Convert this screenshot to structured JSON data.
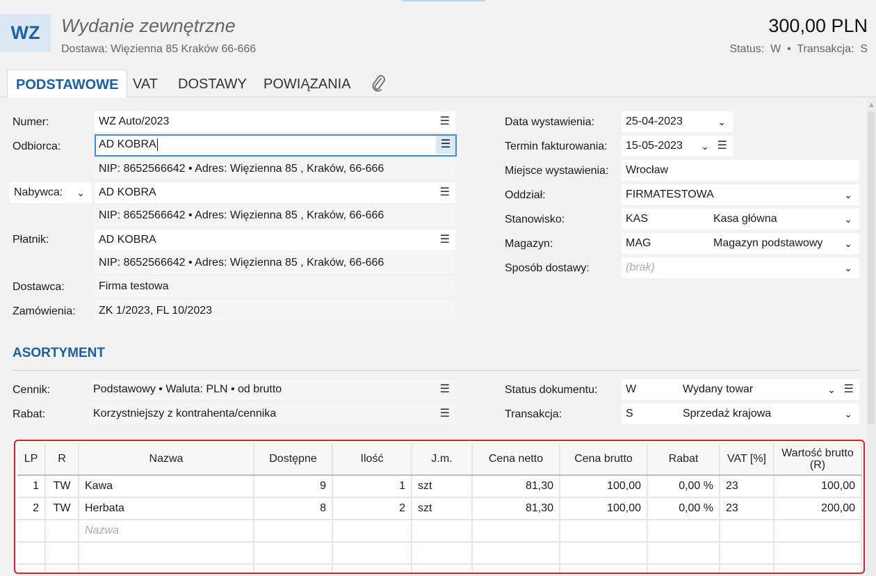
{
  "header": {
    "doc_code": "WZ",
    "title": "Wydanie zewnętrzne",
    "subtitle": "Dostawa: Więzienna  85  Kraków 66-666",
    "amount": "300,00 PLN",
    "status_line": "Status:  W  •  Transakcja:  S"
  },
  "tabs": [
    {
      "label": "PODSTAWOWE",
      "active": true
    },
    {
      "label": "VAT"
    },
    {
      "label": "DOSTAWY"
    },
    {
      "label": "POWIĄZANIA"
    }
  ],
  "left": {
    "numer_label": "Numer:",
    "numer_value": "WZ Auto/2023",
    "odbiorca_label": "Odbiorca:",
    "odbiorca_value": "AD KOBRA",
    "odbiorca_info": "NIP:  8652566642  •  Adres:  Więzienna  85 , Kraków, 66-666",
    "nabywca_label": "Nabywca:",
    "nabywca_value": "AD KOBRA",
    "nabywca_info": "NIP:  8652566642  •  Adres:  Więzienna  85 , Kraków, 66-666",
    "platnik_label": "Płatnik:",
    "platnik_value": "AD KOBRA",
    "platnik_info": "NIP:  8652566642  •  Adres:  Więzienna  85 , Kraków, 66-666",
    "dostawca_label": "Dostawca:",
    "dostawca_value": "Firma testowa",
    "zamowienia_label": "Zamówienia:",
    "zamowienia_value": "ZK 1/2023, FL 10/2023"
  },
  "right": {
    "data_wyst_label": "Data wystawienia:",
    "data_wyst_value": "25-04-2023",
    "termin_label": "Termin fakturowania:",
    "termin_value": "15-05-2023",
    "miejsce_label": "Miejsce wystawienia:",
    "miejsce_value": "Wrocław",
    "oddzial_label": "Oddział:",
    "oddzial_value": "FIRMATESTOWA",
    "stanowisko_label": "Stanowisko:",
    "stanowisko_code": "KAS",
    "stanowisko_name": "Kasa główna",
    "magazyn_label": "Magazyn:",
    "magazyn_code": "MAG",
    "magazyn_name": "Magazyn podstawowy",
    "sposob_label": "Sposób dostawy:",
    "sposob_placeholder": "(brak)"
  },
  "asortyment": {
    "title": "ASORTYMENT",
    "cennik_label": "Cennik:",
    "cennik_value": "Podstawowy • Waluta: PLN • od brutto",
    "rabat_label": "Rabat:",
    "rabat_value": "Korzystniejszy z kontrahenta/cennika",
    "status_label": "Status dokumentu:",
    "status_code": "W",
    "status_name": "Wydany towar",
    "transakcja_label": "Transakcja:",
    "transakcja_code": "S",
    "transakcja_name": "Sprzedaż krajowa"
  },
  "table": {
    "headers": [
      "LP",
      "R",
      "Nazwa",
      "Dostępne",
      "Ilość",
      "J.m.",
      "Cena netto",
      "Cena brutto",
      "Rabat",
      "VAT [%]",
      "Wartość brutto (R)"
    ],
    "rows": [
      [
        "1",
        "TW",
        "Kawa",
        "9",
        "1",
        "szt",
        "81,30",
        "100,00",
        "0,00 %",
        "23",
        "100,00"
      ],
      [
        "2",
        "TW",
        "Herbata",
        "8",
        "2",
        "szt",
        "81,30",
        "100,00",
        "0,00 %",
        "23",
        "200,00"
      ]
    ],
    "new_row_placeholder": "Nazwa"
  },
  "icons": {
    "hamburger": "☰",
    "chevron": "⌄",
    "paperclip": "paperclip-icon"
  }
}
